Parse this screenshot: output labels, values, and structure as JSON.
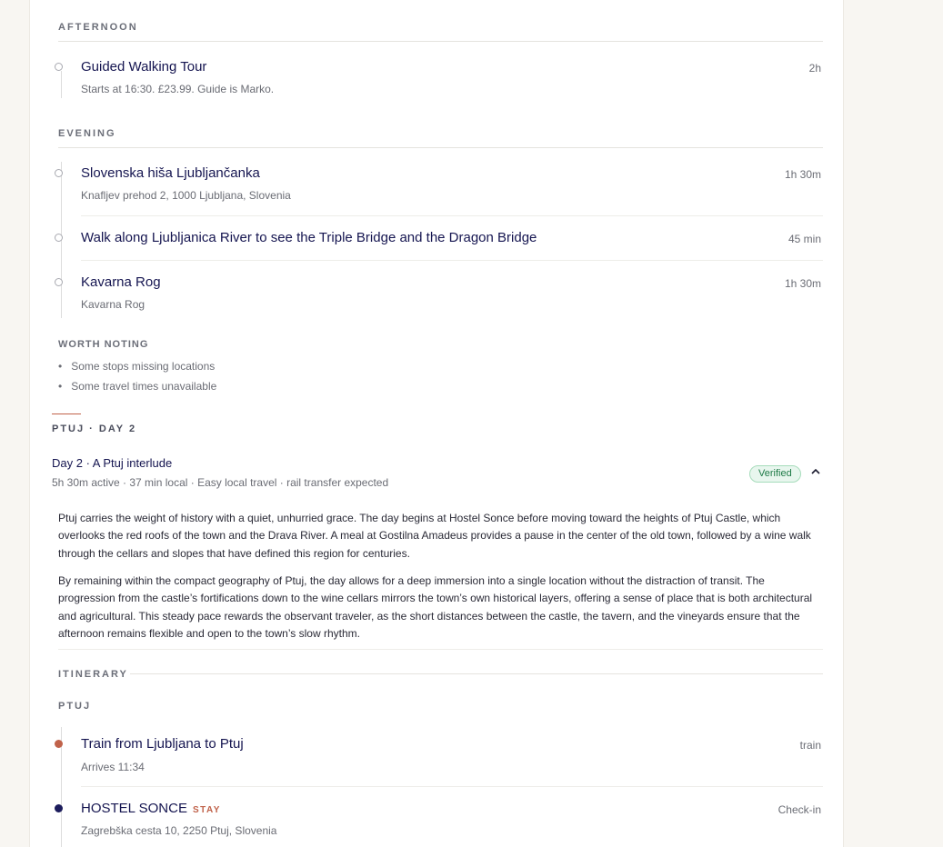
{
  "afternoon": {
    "label": "AFTERNOON",
    "items": [
      {
        "title": "Guided Walking Tour",
        "sub": "Starts at 16:30. £23.99. Guide is Marko.",
        "duration": "2h"
      }
    ]
  },
  "evening": {
    "label": "EVENING",
    "items": [
      {
        "title": "Slovenska hiša Ljubljančanka",
        "sub": "Knafljev prehod 2, 1000 Ljubljana, Slovenia",
        "duration": "1h 30m"
      },
      {
        "title": "Walk along Ljubljanica River to see the Triple Bridge and the Dragon Bridge",
        "duration": "45 min"
      },
      {
        "title": "Kavarna Rog",
        "sub": "Kavarna Rog",
        "duration": "1h 30m"
      }
    ]
  },
  "worth_noting": {
    "label": "WORTH NOTING",
    "notes": [
      "Some stops missing locations",
      "Some travel times unavailable"
    ]
  },
  "day2": {
    "kicker": "PTUJ · DAY 2",
    "title": "Day 2 · A Ptuj interlude",
    "meta": "5h 30m active · 37 min local · Easy local travel · rail transfer expected",
    "badge": "Verified",
    "paragraphs": [
      "Ptuj carries the weight of history with a quiet, unhurried grace. The day begins at Hostel Sonce before moving toward the heights of Ptuj Castle, which overlooks the red roofs of the town and the Drava River. A meal at Gostilna Amadeus provides a pause in the center of the old town, followed by a wine walk through the cellars and slopes that have defined this region for centuries.",
      "By remaining within the compact geography of Ptuj, the day allows for a deep immersion into a single location without the distraction of transit. The progression from the castle’s fortifications down to the wine cellars mirrors the town’s own historical layers, offering a sense of place that is both architectural and agricultural. This steady pace rewards the observant traveler, as the short distances between the castle, the tavern, and the vineyards ensure that the afternoon remains flexible and open to the town’s slow rhythm."
    ],
    "itinerary_label": "ITINERARY",
    "place_label": "PTUJ",
    "items": [
      {
        "title": "Train from Ljubljana to Ptuj",
        "sub": "Arrives 11:34",
        "duration": "train"
      },
      {
        "title": "HOSTEL SONCE",
        "tag": "STAY",
        "sub": "Zagrebška cesta 10, 2250 Ptuj, Slovenia",
        "duration": "Check-in"
      }
    ]
  },
  "colors": {
    "accent": "#c0624a",
    "navy": "#1c1c5c",
    "verified_bg": "#e8f6ee",
    "verified_text": "#1e7a47"
  },
  "icons": {
    "collapse": "chevron-up-icon"
  }
}
